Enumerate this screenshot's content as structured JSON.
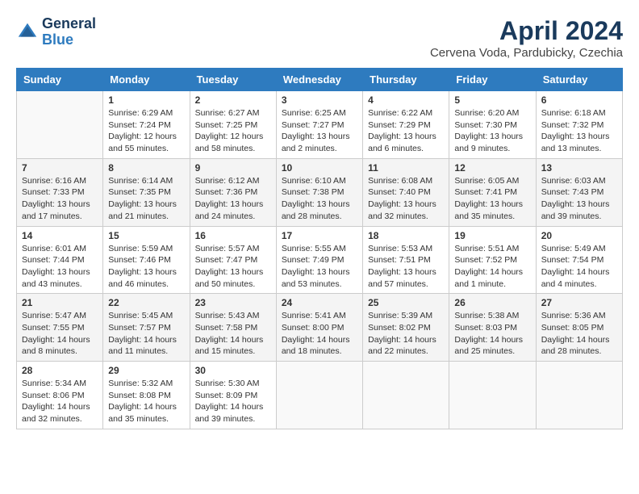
{
  "header": {
    "logo_general": "General",
    "logo_blue": "Blue",
    "title": "April 2024",
    "location": "Cervena Voda, Pardubicky, Czechia"
  },
  "weekdays": [
    "Sunday",
    "Monday",
    "Tuesday",
    "Wednesday",
    "Thursday",
    "Friday",
    "Saturday"
  ],
  "weeks": [
    [
      {
        "day": "",
        "content": ""
      },
      {
        "day": "1",
        "content": "Sunrise: 6:29 AM\nSunset: 7:24 PM\nDaylight: 12 hours\nand 55 minutes."
      },
      {
        "day": "2",
        "content": "Sunrise: 6:27 AM\nSunset: 7:25 PM\nDaylight: 12 hours\nand 58 minutes."
      },
      {
        "day": "3",
        "content": "Sunrise: 6:25 AM\nSunset: 7:27 PM\nDaylight: 13 hours\nand 2 minutes."
      },
      {
        "day": "4",
        "content": "Sunrise: 6:22 AM\nSunset: 7:29 PM\nDaylight: 13 hours\nand 6 minutes."
      },
      {
        "day": "5",
        "content": "Sunrise: 6:20 AM\nSunset: 7:30 PM\nDaylight: 13 hours\nand 9 minutes."
      },
      {
        "day": "6",
        "content": "Sunrise: 6:18 AM\nSunset: 7:32 PM\nDaylight: 13 hours\nand 13 minutes."
      }
    ],
    [
      {
        "day": "7",
        "content": "Sunrise: 6:16 AM\nSunset: 7:33 PM\nDaylight: 13 hours\nand 17 minutes."
      },
      {
        "day": "8",
        "content": "Sunrise: 6:14 AM\nSunset: 7:35 PM\nDaylight: 13 hours\nand 21 minutes."
      },
      {
        "day": "9",
        "content": "Sunrise: 6:12 AM\nSunset: 7:36 PM\nDaylight: 13 hours\nand 24 minutes."
      },
      {
        "day": "10",
        "content": "Sunrise: 6:10 AM\nSunset: 7:38 PM\nDaylight: 13 hours\nand 28 minutes."
      },
      {
        "day": "11",
        "content": "Sunrise: 6:08 AM\nSunset: 7:40 PM\nDaylight: 13 hours\nand 32 minutes."
      },
      {
        "day": "12",
        "content": "Sunrise: 6:05 AM\nSunset: 7:41 PM\nDaylight: 13 hours\nand 35 minutes."
      },
      {
        "day": "13",
        "content": "Sunrise: 6:03 AM\nSunset: 7:43 PM\nDaylight: 13 hours\nand 39 minutes."
      }
    ],
    [
      {
        "day": "14",
        "content": "Sunrise: 6:01 AM\nSunset: 7:44 PM\nDaylight: 13 hours\nand 43 minutes."
      },
      {
        "day": "15",
        "content": "Sunrise: 5:59 AM\nSunset: 7:46 PM\nDaylight: 13 hours\nand 46 minutes."
      },
      {
        "day": "16",
        "content": "Sunrise: 5:57 AM\nSunset: 7:47 PM\nDaylight: 13 hours\nand 50 minutes."
      },
      {
        "day": "17",
        "content": "Sunrise: 5:55 AM\nSunset: 7:49 PM\nDaylight: 13 hours\nand 53 minutes."
      },
      {
        "day": "18",
        "content": "Sunrise: 5:53 AM\nSunset: 7:51 PM\nDaylight: 13 hours\nand 57 minutes."
      },
      {
        "day": "19",
        "content": "Sunrise: 5:51 AM\nSunset: 7:52 PM\nDaylight: 14 hours\nand 1 minute."
      },
      {
        "day": "20",
        "content": "Sunrise: 5:49 AM\nSunset: 7:54 PM\nDaylight: 14 hours\nand 4 minutes."
      }
    ],
    [
      {
        "day": "21",
        "content": "Sunrise: 5:47 AM\nSunset: 7:55 PM\nDaylight: 14 hours\nand 8 minutes."
      },
      {
        "day": "22",
        "content": "Sunrise: 5:45 AM\nSunset: 7:57 PM\nDaylight: 14 hours\nand 11 minutes."
      },
      {
        "day": "23",
        "content": "Sunrise: 5:43 AM\nSunset: 7:58 PM\nDaylight: 14 hours\nand 15 minutes."
      },
      {
        "day": "24",
        "content": "Sunrise: 5:41 AM\nSunset: 8:00 PM\nDaylight: 14 hours\nand 18 minutes."
      },
      {
        "day": "25",
        "content": "Sunrise: 5:39 AM\nSunset: 8:02 PM\nDaylight: 14 hours\nand 22 minutes."
      },
      {
        "day": "26",
        "content": "Sunrise: 5:38 AM\nSunset: 8:03 PM\nDaylight: 14 hours\nand 25 minutes."
      },
      {
        "day": "27",
        "content": "Sunrise: 5:36 AM\nSunset: 8:05 PM\nDaylight: 14 hours\nand 28 minutes."
      }
    ],
    [
      {
        "day": "28",
        "content": "Sunrise: 5:34 AM\nSunset: 8:06 PM\nDaylight: 14 hours\nand 32 minutes."
      },
      {
        "day": "29",
        "content": "Sunrise: 5:32 AM\nSunset: 8:08 PM\nDaylight: 14 hours\nand 35 minutes."
      },
      {
        "day": "30",
        "content": "Sunrise: 5:30 AM\nSunset: 8:09 PM\nDaylight: 14 hours\nand 39 minutes."
      },
      {
        "day": "",
        "content": ""
      },
      {
        "day": "",
        "content": ""
      },
      {
        "day": "",
        "content": ""
      },
      {
        "day": "",
        "content": ""
      }
    ]
  ]
}
